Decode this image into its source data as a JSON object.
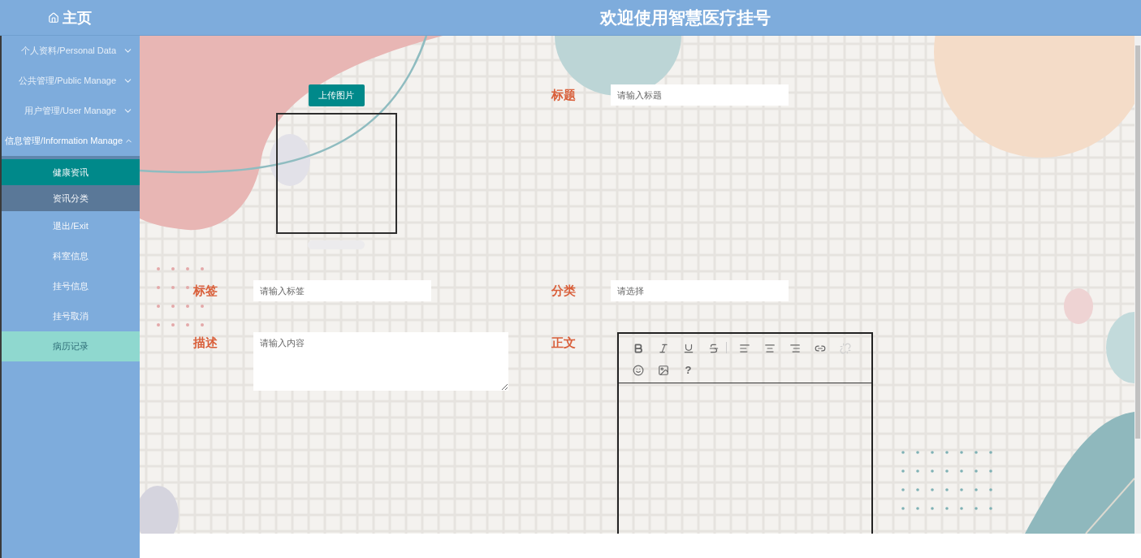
{
  "header": {
    "home_label": "主页",
    "title": "欢迎使用智慧医疗挂号"
  },
  "sidebar": {
    "items": [
      {
        "label": "个人资料/Personal Data",
        "expanded": false
      },
      {
        "label": "公共管理/Public Manage",
        "expanded": false
      },
      {
        "label": "用户管理/User Manage",
        "expanded": false
      },
      {
        "label": "信息管理/Information Manage",
        "expanded": true,
        "children": [
          {
            "label": "健康资讯",
            "selected": true,
            "hovered": false,
            "highlighted": false
          },
          {
            "label": "资讯分类",
            "selected": false,
            "hovered": true,
            "highlighted": false
          }
        ]
      },
      {
        "label": "退出/Exit",
        "selected": false,
        "hovered": false,
        "highlighted": false
      },
      {
        "label": "科室信息",
        "selected": false,
        "hovered": false,
        "highlighted": false
      },
      {
        "label": "挂号信息",
        "selected": false,
        "hovered": false,
        "highlighted": false
      },
      {
        "label": "挂号取消",
        "selected": false,
        "hovered": false,
        "highlighted": false
      },
      {
        "label": "病历记录",
        "selected": false,
        "hovered": false,
        "highlighted": true
      }
    ]
  },
  "form": {
    "upload_button": "上传图片",
    "fields": [
      {
        "label": "标题",
        "kind": "input",
        "placeholder": "请输入标题"
      },
      {
        "label": "标签",
        "kind": "input",
        "placeholder": "请输入标签"
      },
      {
        "label": "分类",
        "kind": "select",
        "placeholder": "请选择"
      },
      {
        "label": "描述",
        "kind": "textarea",
        "placeholder": "请输入内容"
      }
    ],
    "body_label": "正文",
    "editor_toolbar": [
      {
        "kind": "bold",
        "disabled": false
      },
      {
        "kind": "italic",
        "disabled": false
      },
      {
        "kind": "underline",
        "disabled": false
      },
      {
        "kind": "strike",
        "disabled": false
      },
      {
        "kind": "divider"
      },
      {
        "kind": "align-left",
        "disabled": false
      },
      {
        "kind": "align-center",
        "disabled": false
      },
      {
        "kind": "align-right",
        "disabled": false
      },
      {
        "kind": "link",
        "disabled": false
      },
      {
        "kind": "unlink",
        "disabled": true
      },
      {
        "kind": "emoji",
        "disabled": false
      },
      {
        "kind": "image",
        "disabled": false
      },
      {
        "kind": "help",
        "disabled": false,
        "glyph": "?"
      }
    ]
  }
}
